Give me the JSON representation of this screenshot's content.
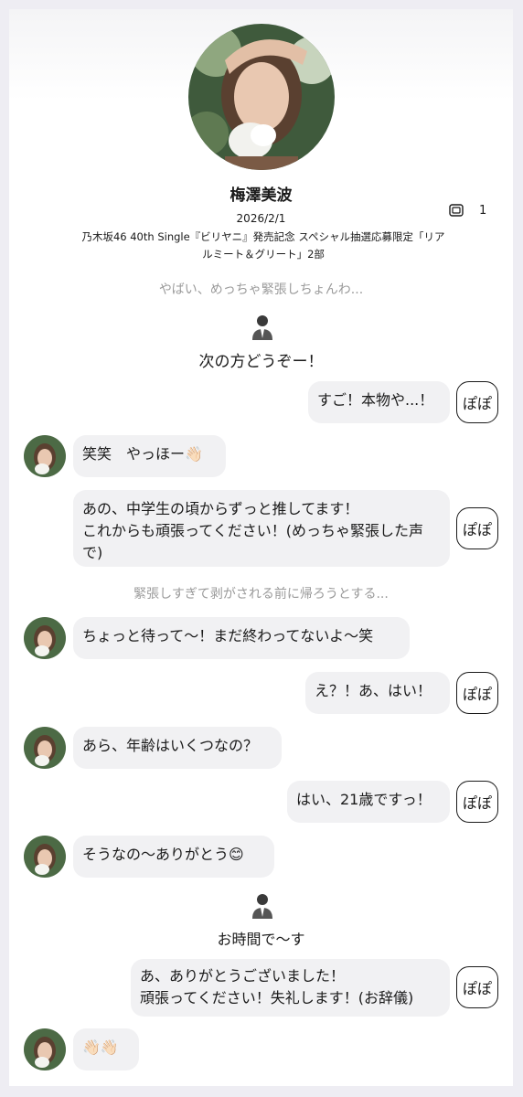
{
  "profile": {
    "name": "梅澤美波",
    "date": "2026/2/1",
    "ticket_count": "1",
    "event_title": "乃木坂46 40th Single『ビリヤニ』発売記念 スペシャル抽選応募限定「リアルミート＆グリート」2部"
  },
  "narrations": [
    "やばい、めっちゃ緊張しちょんわ...",
    "緊張しすぎて剥がされる前に帰ろうとする..."
  ],
  "staff": [
    "次の方どうぞー！",
    "お時間で〜す"
  ],
  "user_label": "ぽぽ",
  "messages": [
    {
      "from": "user",
      "text": "すご！本物や...！"
    },
    {
      "from": "idol",
      "text": "笑笑　やっほー👋🏻"
    },
    {
      "from": "user",
      "text": "あの、中学生の頃からずっと推してます！\nこれからも頑張ってください！(めっちゃ緊張した声で)"
    },
    {
      "from": "idol",
      "text": "ちょっと待って〜！まだ終わってないよ〜笑"
    },
    {
      "from": "user",
      "text": "え？！あ、はい！"
    },
    {
      "from": "idol",
      "text": "あら、年齢はいくつなの？"
    },
    {
      "from": "user",
      "text": "はい、21歳ですっ！"
    },
    {
      "from": "idol",
      "text": "そうなの〜ありがとう😊"
    },
    {
      "from": "user",
      "text": "あ、ありがとうございました！\n頑張ってください！失礼します！(お辞儀)"
    },
    {
      "from": "idol",
      "text": "👋🏻👋🏻"
    }
  ],
  "colors": {
    "background": "#eeedf3",
    "bubble": "#f1f1f3",
    "narration_text": "#9a9a9a"
  }
}
